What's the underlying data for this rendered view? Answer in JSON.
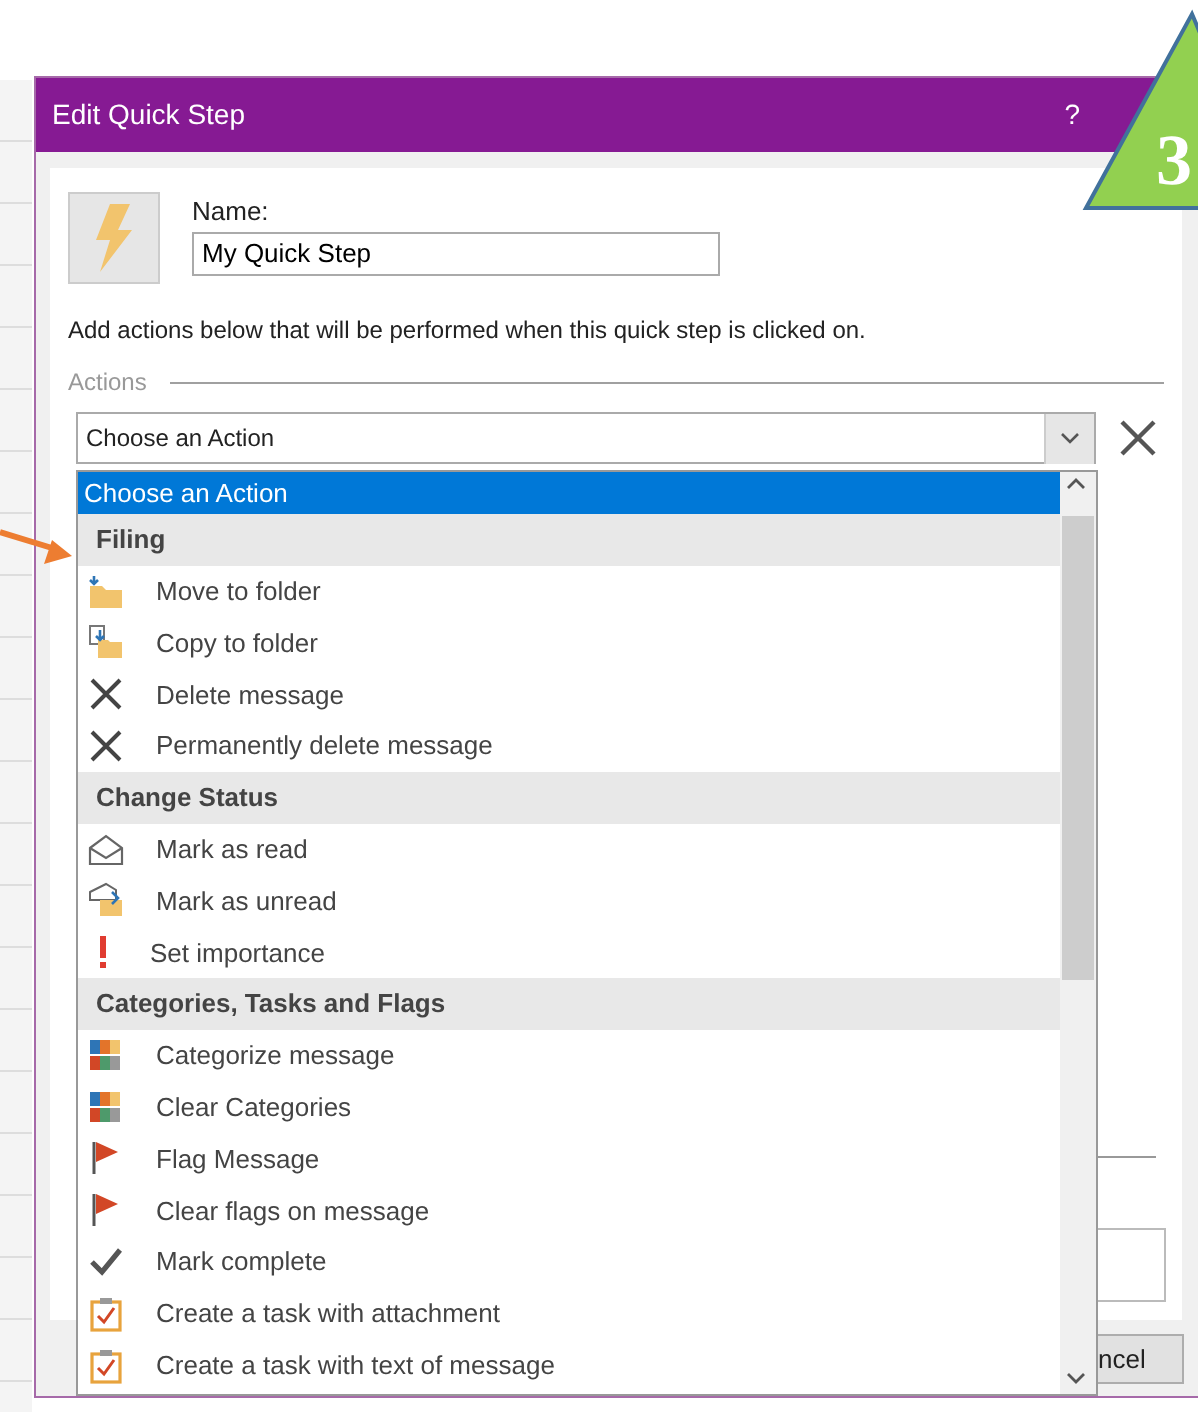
{
  "window": {
    "title": "Edit Quick Step",
    "help": "?"
  },
  "name_field": {
    "label": "Name:",
    "value": "My Quick Step"
  },
  "instructions": "Add actions below that will be performed when this quick step is clicked on.",
  "actions_label": "Actions",
  "action_combo": {
    "value": "Choose an Action"
  },
  "dropdown": [
    {
      "kind": "option",
      "label": "Choose an Action",
      "selected": true
    },
    {
      "kind": "header",
      "label": "Filing"
    },
    {
      "kind": "option",
      "label": "Move to folder",
      "selected": false
    },
    {
      "kind": "option",
      "label": "Copy to folder",
      "selected": false
    },
    {
      "kind": "option",
      "label": "Delete message",
      "selected": false
    },
    {
      "kind": "option",
      "label": "Permanently delete message",
      "selected": false
    },
    {
      "kind": "header",
      "label": "Change Status"
    },
    {
      "kind": "option",
      "label": "Mark as read",
      "selected": false
    },
    {
      "kind": "option",
      "label": "Mark as unread",
      "selected": false
    },
    {
      "kind": "option",
      "label": "Set importance",
      "selected": false
    },
    {
      "kind": "header",
      "label": "Categories, Tasks and Flags"
    },
    {
      "kind": "option",
      "label": "Categorize message",
      "selected": false
    },
    {
      "kind": "option",
      "label": "Clear Categories",
      "selected": false
    },
    {
      "kind": "option",
      "label": "Flag Message",
      "selected": false
    },
    {
      "kind": "option",
      "label": "Clear flags on message",
      "selected": false
    },
    {
      "kind": "option",
      "label": "Mark complete",
      "selected": false
    },
    {
      "kind": "option",
      "label": "Create a task with attachment",
      "selected": false
    },
    {
      "kind": "option",
      "label": "Create a task with text of message",
      "selected": false
    }
  ],
  "cancel_button": "ncel",
  "callout": {
    "number": "3"
  }
}
